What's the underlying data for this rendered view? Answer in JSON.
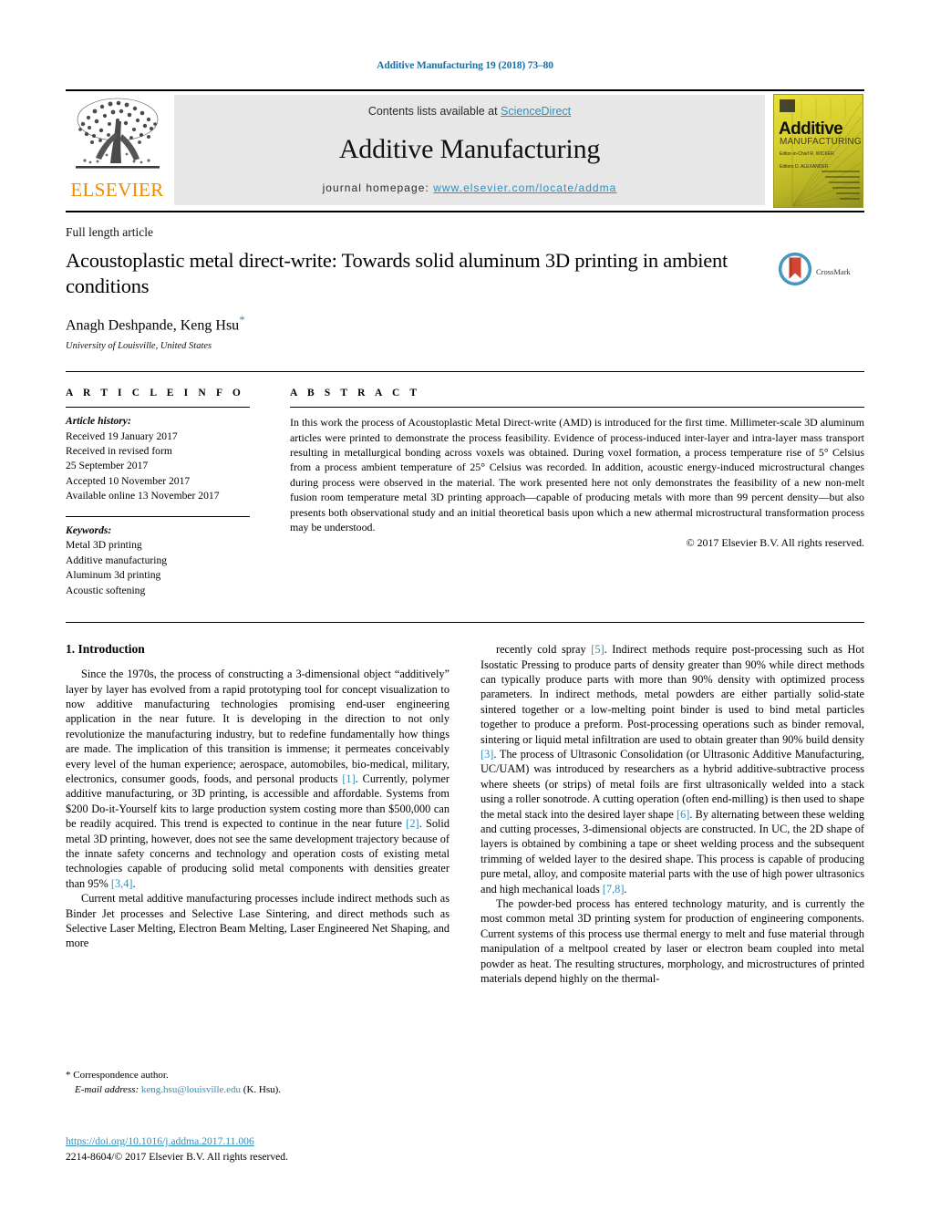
{
  "running_head": "Additive Manufacturing 19 (2018) 73–80",
  "masthead": {
    "publisher_name": "ELSEVIER",
    "contents_prefix": "Contents lists available at ",
    "sciencedirect_link": "ScienceDirect",
    "journal_title": "Additive Manufacturing",
    "homepage_prefix": "journal homepage: ",
    "homepage_url": "www.elsevier.com/locate/addma",
    "cover": {
      "title": "Additive",
      "subtitle": "MANUFACTURING",
      "editor_a": "Editor-in-Chief\nR. WICKER",
      "editor_b": "Editors\nD. ALEXANDER"
    },
    "band_color": "#e7e7e7",
    "link_color": "#2c8fbe",
    "elsevier_orange": "#ED8B00"
  },
  "article": {
    "type": "Full length article",
    "title": "Acoustoplastic metal direct-write: Towards solid aluminum 3D printing in ambient conditions",
    "authors": "Anagh Deshpande, Keng Hsu",
    "corresponding_marker": "*",
    "affiliation": "University of Louisville, United States",
    "crossmark_label": "CrossMark"
  },
  "article_info": {
    "heading": "A R T I C L E   I N F O",
    "history_label": "Article history:",
    "history": [
      "Received 19 January 2017",
      "Received in revised form",
      "25 September 2017",
      "Accepted 10 November 2017",
      "Available online 13 November 2017"
    ],
    "keywords_label": "Keywords:",
    "keywords": [
      "Metal 3D printing",
      "Additive manufacturing",
      "Aluminum 3d printing",
      "Acoustic softening"
    ]
  },
  "abstract": {
    "heading": "A B S T R A C T",
    "text": "In this work the process of Acoustoplastic Metal Direct-write (AMD) is introduced for the first time. Millimeter-scale 3D aluminum articles were printed to demonstrate the process feasibility. Evidence of process-induced inter-layer and intra-layer mass transport resulting in metallurgical bonding across voxels was obtained. During voxel formation, a process temperature rise of 5° Celsius from a process ambient temperature of 25° Celsius was recorded. In addition, acoustic energy-induced microstructural changes during process were observed in the material. The work presented here not only demonstrates the feasibility of a new non-melt fusion room temperature metal 3D printing approach—capable of producing metals with more than 99 percent density—but also presents both observational study and an initial theoretical basis upon which a new athermal microstructural transformation process may be understood.",
    "copyright": "© 2017 Elsevier B.V. All rights reserved."
  },
  "body": {
    "section_number_title": "1.  Introduction",
    "left_paragraphs": [
      {
        "parts": [
          {
            "t": "Since the 1970s, the process of constructing a 3-dimensional object “additively” layer by layer has evolved from a rapid prototyping tool for concept visualization to now additive manufacturing technologies promising end-user engineering application in the near future. It is developing in the direction to not only revolutionize the manufacturing industry, but to redefine fundamentally how things are made. The implication of this transition is immense; it permeates conceivably every level of the human experience; aerospace, automobiles, bio-medical, military, electronics, consumer goods, foods, and personal products "
          },
          {
            "t": "[1]",
            "ref": true
          },
          {
            "t": ". Currently, polymer additive manufacturing, or 3D printing, is accessible and affordable. Systems from $200 Do-it-Yourself kits to large production system costing more than $500,000 can be readily acquired. This trend is expected to continue in the near future "
          },
          {
            "t": "[2]",
            "ref": true
          },
          {
            "t": ". Solid metal 3D printing, however, does not see the same development trajectory because of the innate safety concerns and technology and operation costs of existing metal technologies capable of producing solid metal components with densities greater than 95% "
          },
          {
            "t": "[3,4]",
            "ref": true
          },
          {
            "t": "."
          }
        ]
      },
      {
        "parts": [
          {
            "t": "Current metal additive manufacturing processes include indirect methods such as Binder Jet processes and Selective Lase Sintering, and direct methods such as Selective Laser Melting, Electron Beam Melting, Laser Engineered Net Shaping, and more"
          }
        ]
      }
    ],
    "right_paragraphs": [
      {
        "parts": [
          {
            "t": "recently cold spray "
          },
          {
            "t": "[5]",
            "ref": true
          },
          {
            "t": ". Indirect methods require post-processing such as Hot Isostatic Pressing to produce parts of density greater than 90% while direct methods can typically produce parts with more than 90% density with optimized process parameters. In indirect methods, metal powders are either partially solid-state sintered together or a low-melting point binder is used to bind metal particles together to produce a preform. Post-processing operations such as binder removal, sintering or liquid metal infiltration are used to obtain greater than 90% build density "
          },
          {
            "t": "[3]",
            "ref": true
          },
          {
            "t": ". The process of Ultrasonic Consolidation (or Ultrasonic Additive Manufacturing, UC/UAM) was introduced by researchers as a hybrid additive-subtractive process where sheets (or strips) of metal foils are first ultrasonically welded into a stack using a roller sonotrode. A cutting operation (often end-milling) is then used to shape the metal stack into the desired layer shape "
          },
          {
            "t": "[6]",
            "ref": true
          },
          {
            "t": ". By alternating between these welding and cutting processes, 3-dimensional objects are constructed. In UC, the 2D shape of layers is obtained by combining a tape or sheet welding process and the subsequent trimming of welded layer to the desired shape. This process is capable of producing pure metal, alloy, and composite material parts with the use of high power ultrasonics and high mechanical loads "
          },
          {
            "t": "[7,8]",
            "ref": true
          },
          {
            "t": "."
          }
        ]
      },
      {
        "parts": [
          {
            "t": "The powder-bed process has entered technology maturity, and is currently the most common metal 3D printing system for production of engineering components. Current systems of this process use thermal energy to melt and fuse material through manipulation of a meltpool created by laser or electron beam coupled into metal powder as heat. The resulting structures, morphology, and microstructures of printed materials depend highly on the thermal-"
          }
        ]
      }
    ]
  },
  "footer": {
    "correspondence_marker": "*",
    "correspondence_label": "Correspondence author.",
    "email_label": "E-mail address:",
    "email": "keng.hsu@louisville.edu",
    "email_suffix": "(K. Hsu).",
    "doi": "https://doi.org/10.1016/j.addma.2017.11.006",
    "issn_line": "2214-8604/© 2017 Elsevier B.V. All rights reserved."
  }
}
